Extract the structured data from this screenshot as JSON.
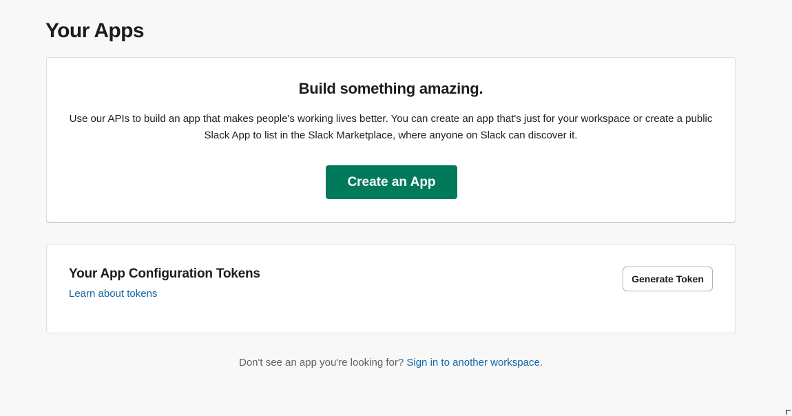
{
  "header": {
    "title": "Your Apps"
  },
  "build_card": {
    "title": "Build something amazing.",
    "description": "Use our APIs to build an app that makes people's working lives better. You can create an app that's just for your workspace or create a public Slack App to list in the Slack Marketplace, where anyone on Slack can discover it.",
    "create_button_label": "Create an App"
  },
  "tokens_card": {
    "title": "Your App Configuration Tokens",
    "learn_link": "Learn about tokens",
    "generate_button_label": "Generate Token"
  },
  "footer": {
    "prompt": "Don't see an app you're looking for?",
    "link": "Sign in to another workspace",
    "trailing": "."
  },
  "colors": {
    "background": "#f8f8f8",
    "primary_button": "#007a5a",
    "link": "#1264a3"
  }
}
